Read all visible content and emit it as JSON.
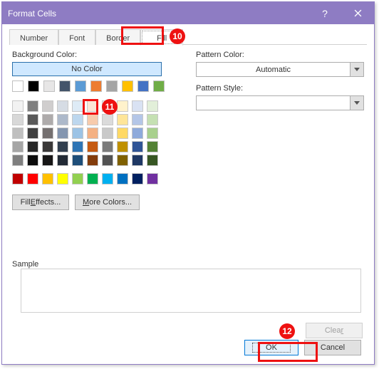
{
  "title": "Format Cells",
  "tabs": {
    "number": "Number",
    "font": "Font",
    "border": "Border",
    "fill": "Fill"
  },
  "labels": {
    "bgcolor": "Background Color:",
    "nocolor": "No Color",
    "patternColor": "Pattern Color:",
    "patternStyle": "Pattern Style:",
    "automatic": "Automatic",
    "sample": "Sample",
    "fillEffects_pre": "Fill ",
    "fillEffects_u": "E",
    "fillEffects_post": "ffects...",
    "moreColors_u": "M",
    "moreColors_post": "ore Colors...",
    "clear": "Clea",
    "clear_u": "r",
    "ok": "OK",
    "cancel": "Cancel"
  },
  "callouts": {
    "tab": "10",
    "swatch": "11",
    "ok": "12"
  },
  "colors": {
    "row1": [
      "#ffffff",
      "#000000",
      "#e7e6e6",
      "#44546a",
      "#5b9bd5",
      "#ed7d31",
      "#a5a5a5",
      "#ffc000",
      "#4472c4",
      "#70ad47"
    ],
    "theme": [
      [
        "#f2f2f2",
        "#7f7f7f",
        "#d0cece",
        "#d6dce4",
        "#deebf6",
        "#fbe5d5",
        "#ededed",
        "#fff2cc",
        "#d9e2f3",
        "#e2efd9"
      ],
      [
        "#d8d8d8",
        "#595959",
        "#aeabab",
        "#adb9ca",
        "#bdd7ee",
        "#f7cbac",
        "#dbdbdb",
        "#fee599",
        "#b4c6e7",
        "#c5e0b3"
      ],
      [
        "#bfbfbf",
        "#3f3f3f",
        "#757070",
        "#8496b0",
        "#9cc3e5",
        "#f4b183",
        "#c9c9c9",
        "#ffd965",
        "#8eaadb",
        "#a8d08d"
      ],
      [
        "#a5a5a5",
        "#262626",
        "#3a3838",
        "#323f4f",
        "#2e75b5",
        "#c55a11",
        "#7b7b7b",
        "#bf9000",
        "#2f5496",
        "#538135"
      ],
      [
        "#7f7f7f",
        "#0c0c0c",
        "#171616",
        "#222a35",
        "#1e4e79",
        "#833c0b",
        "#525252",
        "#7f6000",
        "#1f3864",
        "#375623"
      ]
    ],
    "standard": [
      "#c00000",
      "#ff0000",
      "#ffc000",
      "#ffff00",
      "#92d050",
      "#00b050",
      "#00b0f0",
      "#0070c0",
      "#002060",
      "#7030a0"
    ]
  }
}
